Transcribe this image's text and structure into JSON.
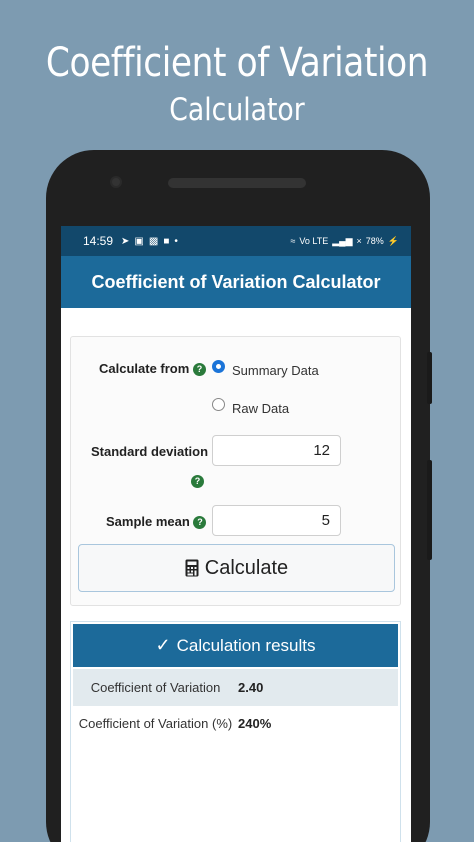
{
  "promo": {
    "line1": "Coefficient of Variation",
    "line2": "Calculator"
  },
  "status": {
    "time": "14:59",
    "battery": "78%",
    "network": "Vo LTE"
  },
  "appbar": {
    "title": "Coefficient of Variation Calculator"
  },
  "form": {
    "calculate_from_label": "Calculate from",
    "options": [
      {
        "label": "Summary Data",
        "selected": true
      },
      {
        "label": "Raw Data",
        "selected": false
      }
    ],
    "std_label": "Standard deviation",
    "std_value": "12",
    "mean_label": "Sample mean",
    "mean_value": "5",
    "help_glyph": "?",
    "calculate_label": "Calculate"
  },
  "results": {
    "header": "Calculation results",
    "rows": [
      {
        "name": "Coefficient of Variation",
        "value": "2.40"
      },
      {
        "name": "Coefficient of Variation (%)",
        "value": "240%"
      }
    ]
  },
  "colors": {
    "background": "#7d9bb1",
    "appbar": "#1c6a9a",
    "statusbar": "#12486b",
    "help": "#2a7a3b",
    "radio_selected": "#1b74d8"
  }
}
